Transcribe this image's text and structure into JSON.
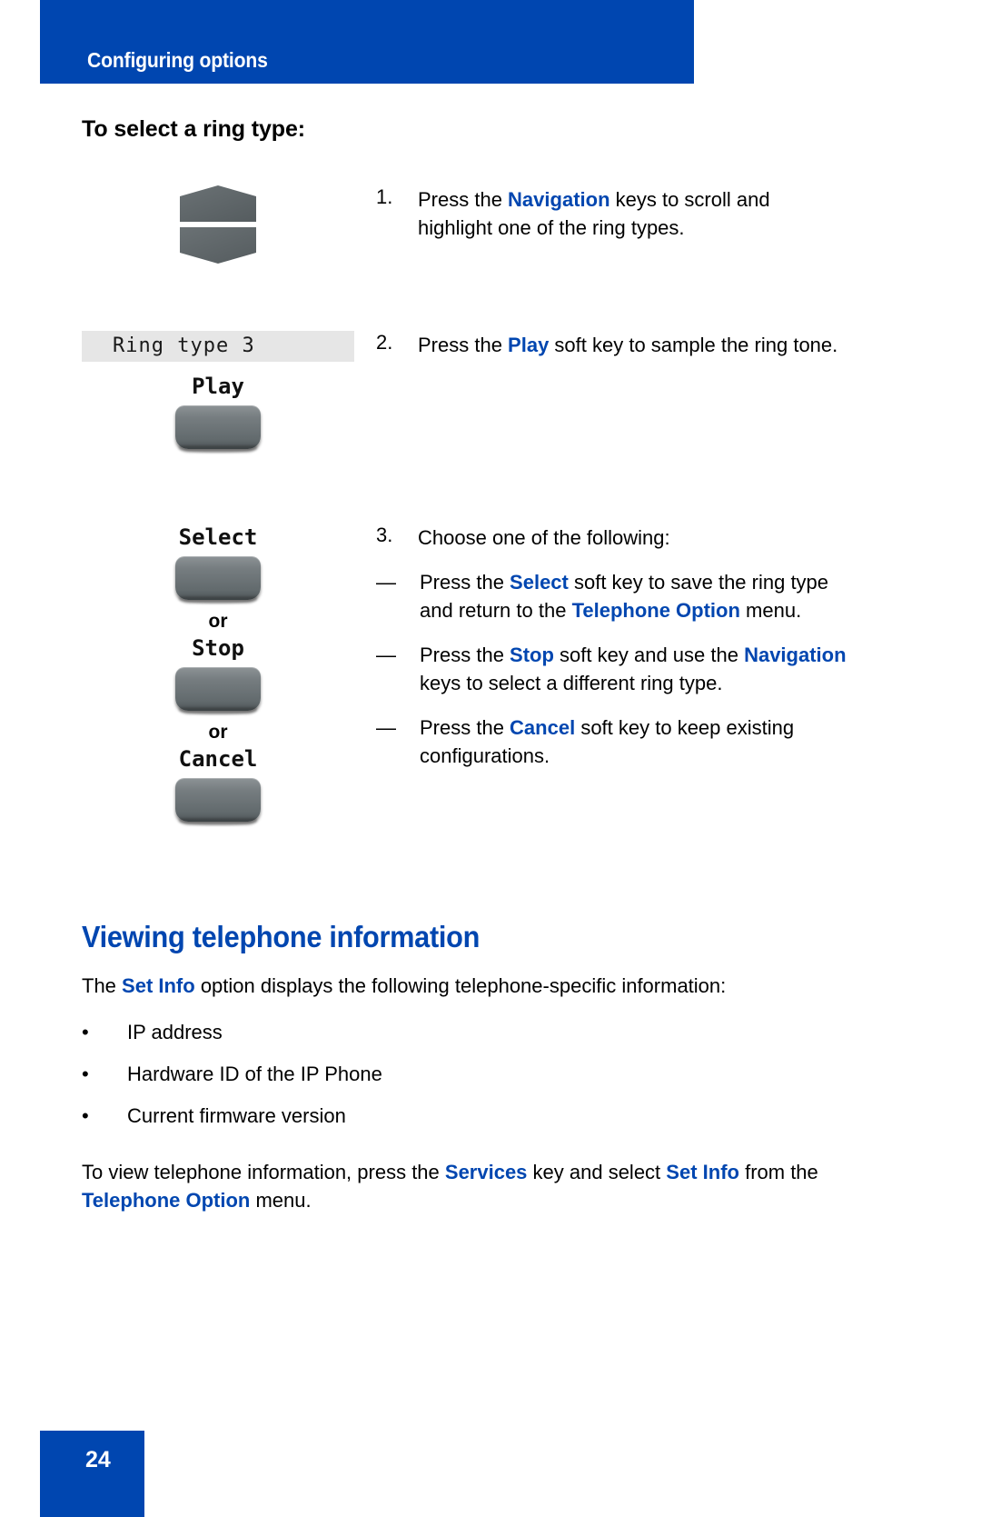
{
  "header": {
    "title": "Configuring options",
    "bar_color": "#0046B0"
  },
  "procedure": {
    "title": "To select a ring type:",
    "steps": [
      {
        "number": "1.",
        "text_parts": [
          {
            "t": "Press the ",
            "kw": false
          },
          {
            "t": "Navigation",
            "kw": true
          },
          {
            "t": " keys to scroll and highlight one of the ring types.",
            "kw": false
          }
        ],
        "art": {
          "type": "navigation-keys"
        }
      },
      {
        "number": "2.",
        "text_parts": [
          {
            "t": "Press the ",
            "kw": false
          },
          {
            "t": "Play",
            "kw": true
          },
          {
            "t": " soft key to sample the ring tone.",
            "kw": false
          }
        ],
        "art": {
          "type": "lcd-and-softkey",
          "lcd_text": "Ring type 3",
          "softkey_label": "Play"
        }
      },
      {
        "number": "3.",
        "text_parts": [
          {
            "t": "Choose one of the following:",
            "kw": false
          }
        ],
        "art": {
          "type": "softkey-choices",
          "or_label": "or",
          "keys": [
            "Select",
            "Stop",
            "Cancel"
          ]
        },
        "sub_items": [
          {
            "dash": "—",
            "parts": [
              {
                "t": "Press the ",
                "kw": false
              },
              {
                "t": "Select",
                "kw": true
              },
              {
                "t": " soft key to save the ring type and return to the ",
                "kw": false
              },
              {
                "t": "Telephone Option",
                "kw": true
              },
              {
                "t": " menu.",
                "kw": false
              }
            ]
          },
          {
            "dash": "—",
            "parts": [
              {
                "t": "Press the ",
                "kw": false
              },
              {
                "t": "Stop",
                "kw": true
              },
              {
                "t": " soft key and use the ",
                "kw": false
              },
              {
                "t": "Navigation",
                "kw": true
              },
              {
                "t": " keys to select a different ring type.",
                "kw": false
              }
            ]
          },
          {
            "dash": "—",
            "parts": [
              {
                "t": "Press the ",
                "kw": false
              },
              {
                "t": "Cancel",
                "kw": true
              },
              {
                "t": " soft key to keep existing configurations.",
                "kw": false
              }
            ]
          }
        ]
      }
    ]
  },
  "section": {
    "heading": "Viewing telephone information",
    "intro_parts": [
      {
        "t": "The ",
        "kw": false
      },
      {
        "t": "Set Info",
        "kw": true
      },
      {
        "t": " option displays the following telephone-specific information:",
        "kw": false
      }
    ],
    "bullet_marker": "•",
    "bullets": [
      "IP address",
      "Hardware ID of the IP Phone",
      "Current firmware version"
    ],
    "closing_parts": [
      {
        "t": "To view telephone information, press the ",
        "kw": false
      },
      {
        "t": "Services",
        "kw": true
      },
      {
        "t": " key and select ",
        "kw": false
      },
      {
        "t": "Set Info",
        "kw": true
      },
      {
        "t": " from the ",
        "kw": false
      },
      {
        "t": "Telephone Option",
        "kw": true
      },
      {
        "t": " menu.",
        "kw": false
      }
    ]
  },
  "footer": {
    "page_number": "24",
    "bar_color": "#0046B0"
  },
  "colors": {
    "brand_blue": "#0046B0",
    "keyword_blue": "#0046B0",
    "lcd_background": "#E6E6E6",
    "key_gray": "#6A7174"
  }
}
